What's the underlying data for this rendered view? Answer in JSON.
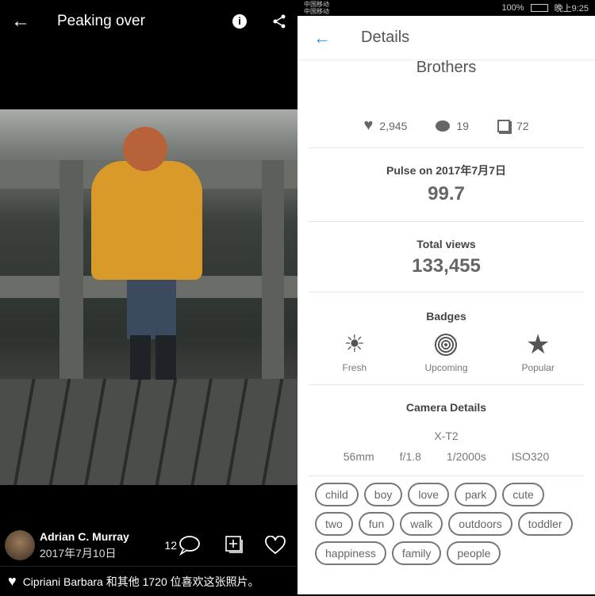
{
  "left": {
    "title": "Peaking over",
    "icons": {
      "back": "arrow-left-icon",
      "info": "info-icon",
      "share": "share-icon"
    },
    "user": {
      "name": "Adrian C. Murray",
      "date": "2017年7月10日"
    },
    "comment_count": "12",
    "likes_text": "Cipriani Barbara 和其他 1720 位喜欢这张照片。"
  },
  "status_bar": {
    "carrier1": "中国移动",
    "carrier2": "中国移动",
    "battery": "100%",
    "time": "晚上9:25"
  },
  "details": {
    "header": "Details",
    "photo_title": "Brothers",
    "stats": {
      "likes": "2,945",
      "comments": "19",
      "galleries": "72"
    },
    "pulse_label": "Pulse on 2017年7月7日",
    "pulse_value": "99.7",
    "views_label": "Total views",
    "views_value": "133,455",
    "badges_label": "Badges",
    "badges": [
      {
        "label": "Fresh",
        "icon": "sun-icon"
      },
      {
        "label": "Upcoming",
        "icon": "rings-icon"
      },
      {
        "label": "Popular",
        "icon": "star-icon"
      }
    ],
    "camera_label": "Camera Details",
    "camera": "X-T2",
    "camera_specs": [
      "56mm",
      "f/1.8",
      "1/2000s",
      "ISO320"
    ],
    "tags": [
      "child",
      "boy",
      "love",
      "park",
      "cute",
      "two",
      "fun",
      "walk",
      "outdoors",
      "toddler",
      "happiness",
      "family",
      "people"
    ],
    "accent": "#2196f3"
  }
}
